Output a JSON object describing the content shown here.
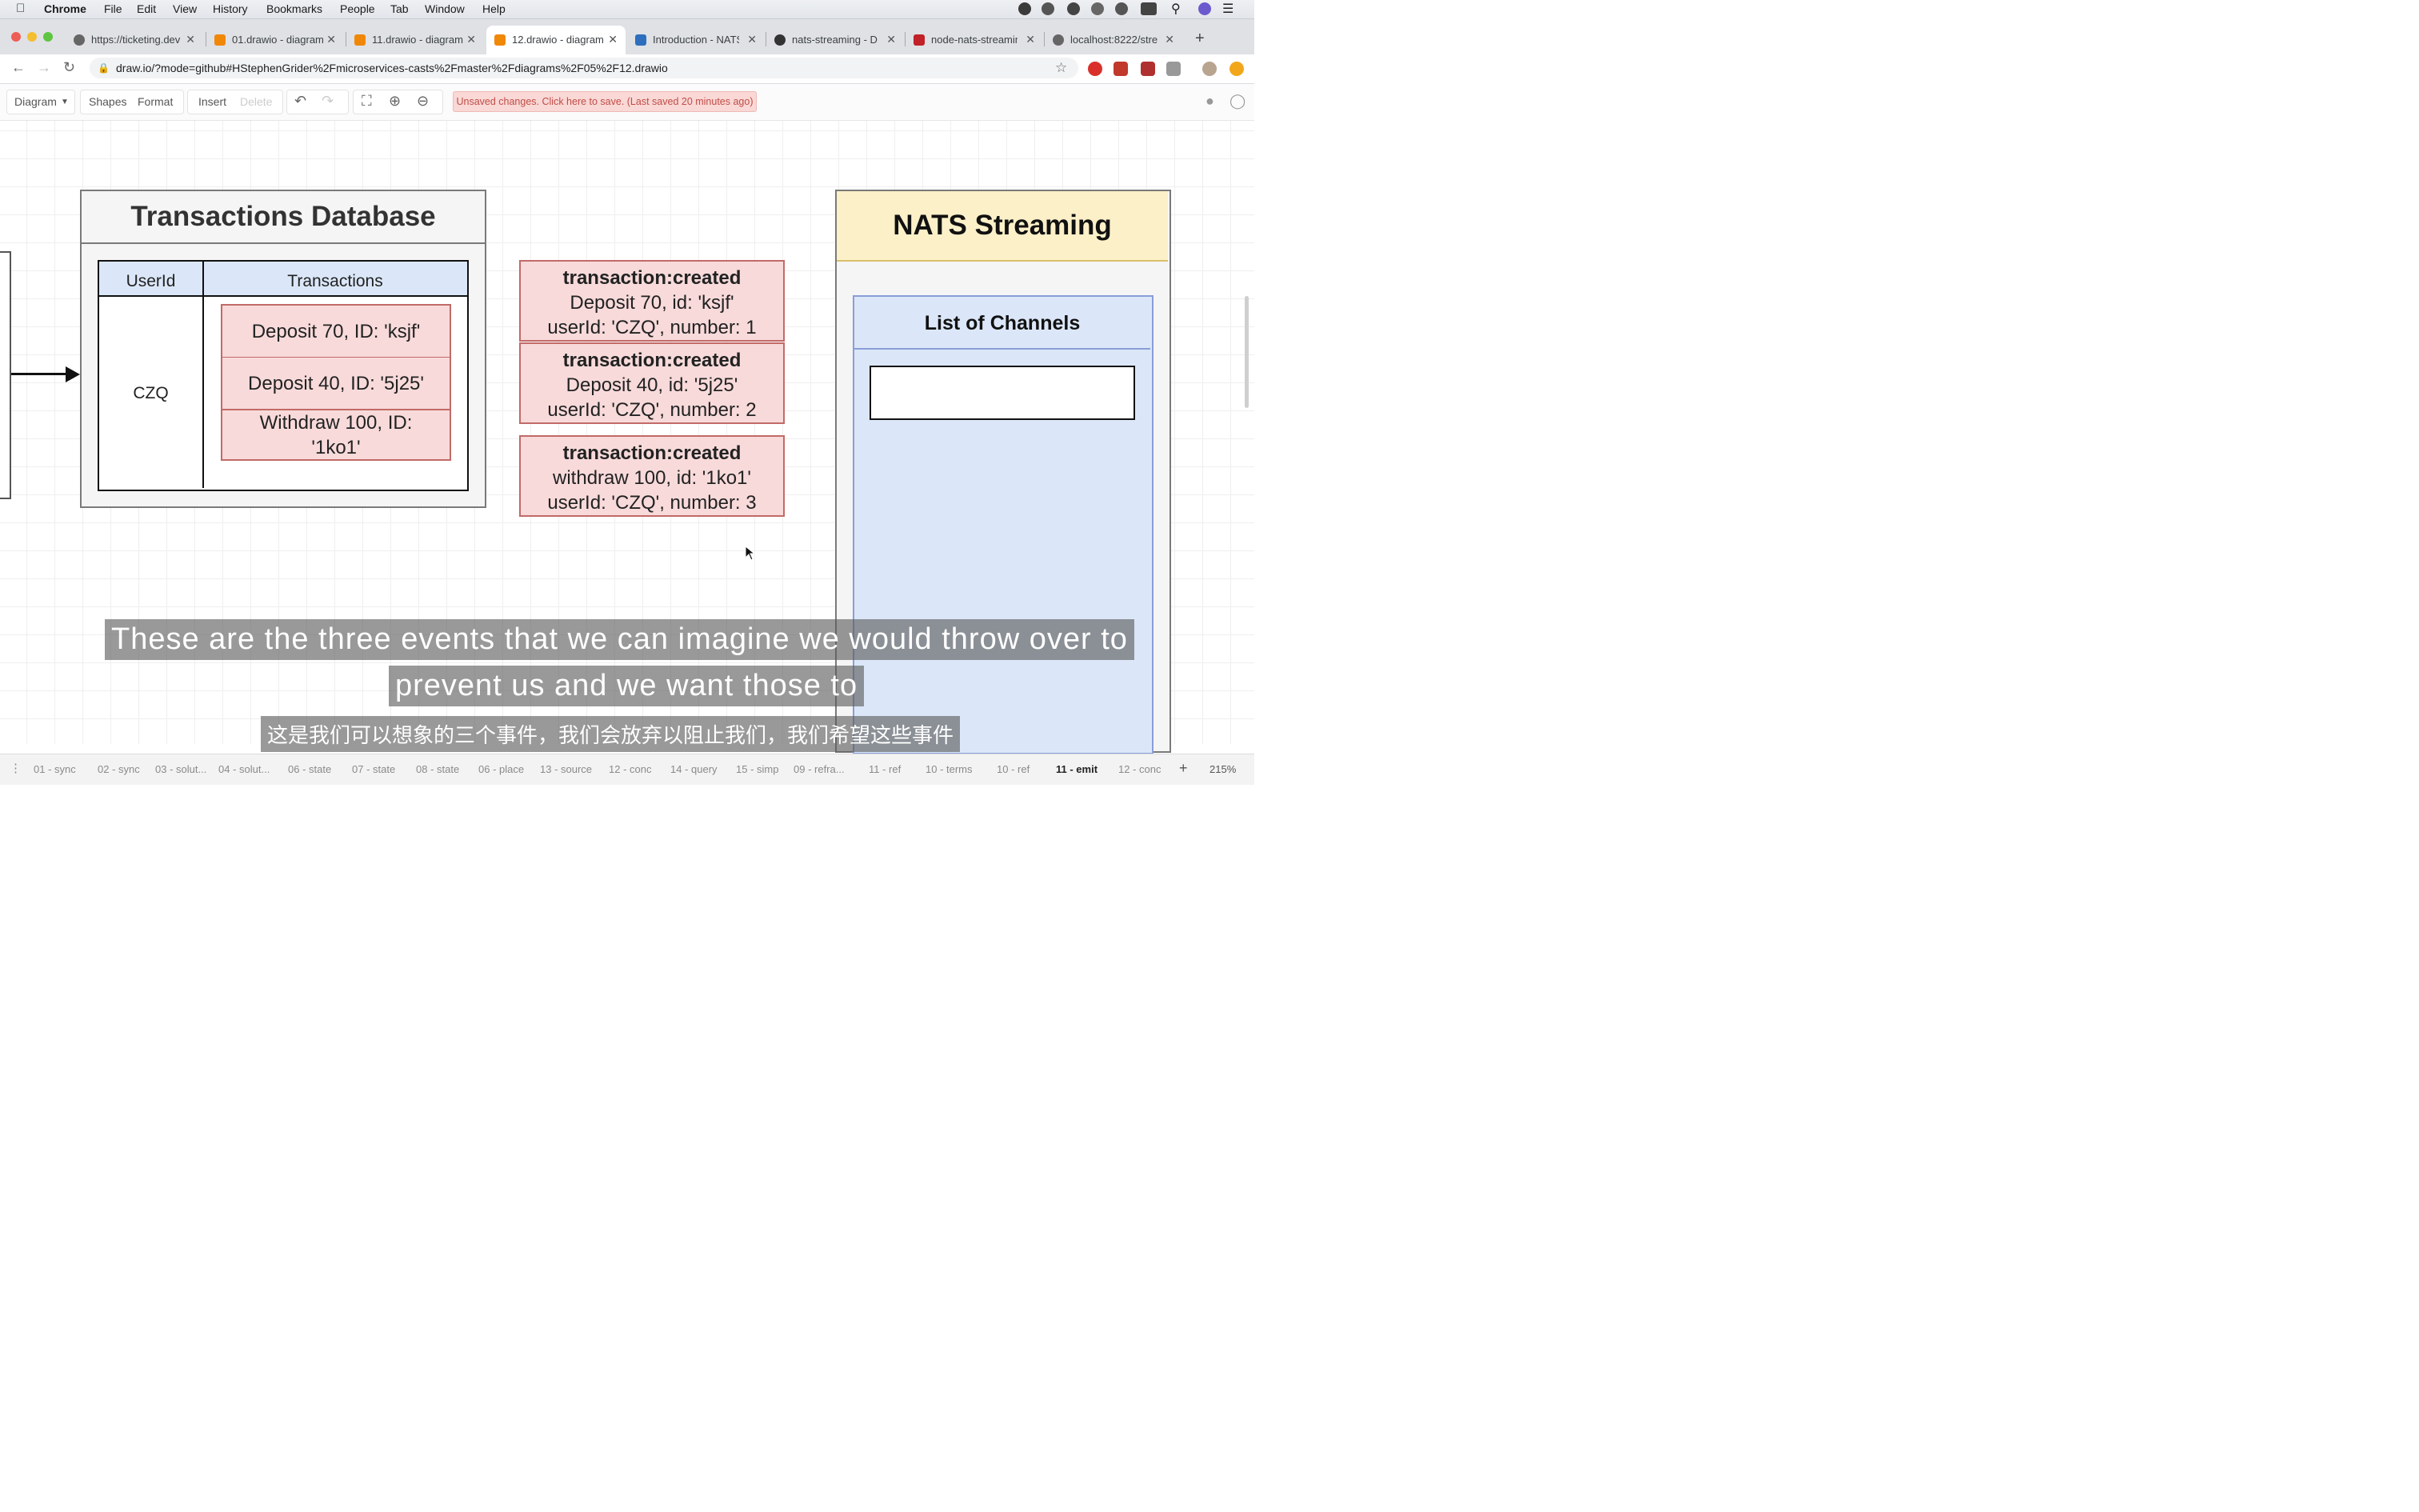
{
  "menubar": {
    "app": "Chrome",
    "items": [
      "File",
      "Edit",
      "View",
      "History",
      "Bookmarks",
      "People",
      "Tab",
      "Window",
      "Help"
    ]
  },
  "browser_tabs": [
    {
      "title": "https://ticketing.dev",
      "icon": "globe-icon"
    },
    {
      "title": "01.drawio - diagram",
      "icon": "drawio-icon"
    },
    {
      "title": "11.drawio - diagram",
      "icon": "drawio-icon"
    },
    {
      "title": "12.drawio - diagram",
      "icon": "drawio-icon",
      "active": true
    },
    {
      "title": "Introduction - NATS",
      "icon": "nats-icon"
    },
    {
      "title": "nats-streaming - D",
      "icon": "github-icon"
    },
    {
      "title": "node-nats-streaming",
      "icon": "npm-icon"
    },
    {
      "title": "localhost:8222/stre",
      "icon": "globe-icon"
    }
  ],
  "address": {
    "url": "draw.io/?mode=github#HStephenGrider%2Fmicroservices-casts%2Fmaster%2Fdiagrams%2F05%2F12.drawio"
  },
  "toolbar": {
    "diagram": "Diagram",
    "shapes": "Shapes",
    "format": "Format",
    "insert": "Insert",
    "delete": "Delete",
    "unsaved": "Unsaved changes. Click here to save. (Last saved 20 minutes ago)"
  },
  "database": {
    "title": "Transactions Database",
    "col_user": "UserId",
    "col_tx": "Transactions",
    "user": "CZQ",
    "transactions": [
      "Deposit 70, ID: 'ksjf'",
      "Deposit 40, ID: '5j25'",
      "Withdraw 100, ID: '1ko1'"
    ]
  },
  "events": [
    {
      "title": "transaction:created",
      "line1": "Deposit 70, id: 'ksjf'",
      "line2": "userId: 'CZQ', number: 1"
    },
    {
      "title": "transaction:created",
      "line1": "Deposit 40, id: '5j25'",
      "line2": "userId: 'CZQ', number: 2"
    },
    {
      "title": "transaction:created",
      "line1": "withdraw 100, id: '1ko1'",
      "line2": "userId: 'CZQ', number: 3"
    }
  ],
  "nats": {
    "title": "NATS Streaming",
    "channels_title": "List of Channels"
  },
  "subtitles": {
    "en_line1": "These are the three events that we can imagine we would throw over to",
    "en_line2": "prevent us and we want those to",
    "zh": "这是我们可以想象的三个事件，我们会放弃以阻止我们，我们希望这些事件"
  },
  "pages": [
    "01 - sync",
    "02 - sync",
    "03 - solut...",
    "04 - solut...",
    "06 - state",
    "07 - state",
    "08 - state",
    "06 - place",
    "13 - source",
    "12 - conc",
    "14 - query",
    "15 - simp",
    "09 - refra...",
    "11 - ref",
    "10 - terms",
    "10 - ref",
    "11 - emit",
    "12 - conc"
  ],
  "active_page": "11 - emit",
  "zoom": "215%"
}
